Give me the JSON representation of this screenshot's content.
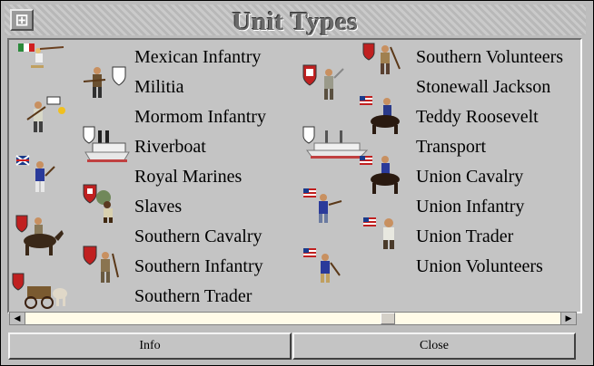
{
  "window": {
    "title": "Unit Types",
    "system_menu_icon": "system-menu-icon"
  },
  "units_left": [
    "Mexican Infantry",
    "Militia",
    "Mormom Infantry",
    "Riverboat",
    "Royal Marines",
    "Slaves",
    "Southern Cavalry",
    "Southern Infantry",
    "Southern Trader"
  ],
  "units_right": [
    "Southern Volunteers",
    "Stonewall Jackson",
    "Teddy Roosevelt",
    "Transport",
    "Union Cavalry",
    "Union Infantry",
    "Union Trader",
    "Union Volunteers"
  ],
  "buttons": {
    "info": "Info",
    "close": "Close"
  },
  "colors": {
    "background": "#bdbdbd",
    "title": "#6a6a6a",
    "scroll_track": "#fffbe8"
  }
}
